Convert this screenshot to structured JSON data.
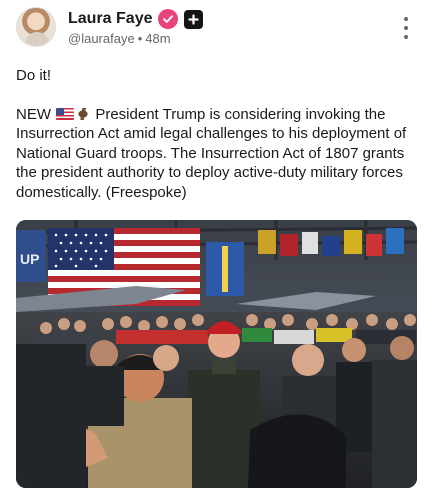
{
  "author": {
    "display_name": "Laura Faye",
    "handle": "@laurafaye",
    "separator": "•",
    "time_ago": "48m",
    "verified_icon": "verified-badge-icon",
    "plus_icon": "plus-badge-icon"
  },
  "post": {
    "line_1": "Do it!",
    "line_2_prefix": "NEW",
    "line_2_body": "President Trump is considering invoking the Insurrection Act amid legal challenges to his deployment of National Guard troops. The Insurrection Act of 1807 grants the president authority to deploy active-duty military forces domestically. (Freespoke)",
    "emojis": [
      "flag-us-icon",
      "eagle-icon"
    ]
  },
  "media": {
    "sign_text": "UP"
  },
  "colors": {
    "verified": "#e8447a",
    "text": "#1a1a1a",
    "muted": "#666666"
  }
}
